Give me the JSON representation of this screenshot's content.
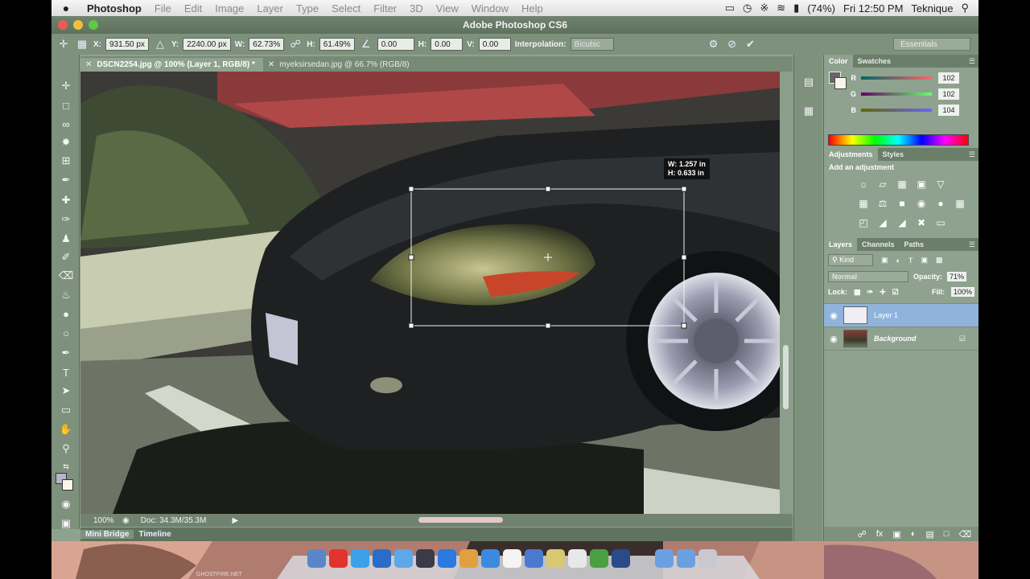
{
  "menubar": {
    "apple": "",
    "app": "Photoshop",
    "items": [
      "File",
      "Edit",
      "Image",
      "Layer",
      "Type",
      "Select",
      "Filter",
      "3D",
      "View",
      "Window",
      "Help"
    ],
    "battery": "(74%)",
    "clock": "Fri 12:50 PM",
    "user": "Teknique"
  },
  "window": {
    "title": "Adobe Photoshop CS6"
  },
  "options": {
    "x_label": "X:",
    "x_value": "931.50 px",
    "y_label": "Y:",
    "y_value": "2240.00 px",
    "w_label": "W:",
    "w_value": "62.73%",
    "h_label": "H:",
    "h_value": "61.49%",
    "angle_value": "0.00",
    "hskew_label": "H:",
    "hskew_value": "0.00",
    "vskew_label": "V:",
    "vskew_value": "0.00",
    "interp_label": "Interpolation:",
    "interp_value": "Bicubic",
    "workspace": "Essentials"
  },
  "doc_tabs": [
    {
      "label": "DSCN2254.jpg @ 100% (Layer 1, RGB/8) *",
      "active": true
    },
    {
      "label": "myeksirsedan.jpg @ 66.7% (RGB/8)",
      "active": false
    }
  ],
  "transform_readout": {
    "w": "W: 1.257 in",
    "h": "H: 0.633 in"
  },
  "status": {
    "zoom": "100%",
    "doc": "Doc: 34.3M/35.3M"
  },
  "bottom_tabs": [
    "Mini Bridge",
    "Timeline"
  ],
  "color_panel": {
    "tabs": [
      "Color",
      "Swatches"
    ],
    "channels": [
      {
        "name": "R",
        "value": "102"
      },
      {
        "name": "G",
        "value": "102"
      },
      {
        "name": "B",
        "value": "104"
      }
    ]
  },
  "adjustments_panel": {
    "tabs": [
      "Adjustments",
      "Styles"
    ],
    "hint": "Add an adjustment"
  },
  "layers_panel": {
    "tabs": [
      "Layers",
      "Channels",
      "Paths"
    ],
    "kind": "Kind",
    "blend": "Normal",
    "opacity_label": "Opacity:",
    "opacity_value": "71%",
    "lock_label": "Lock:",
    "fill_label": "Fill:",
    "fill_value": "100%",
    "layers": [
      {
        "name": "Layer 1",
        "selected": true
      },
      {
        "name": "Background",
        "selected": false
      }
    ]
  },
  "dock": {
    "watermark": "GHOSTFIRE.NET"
  },
  "colors": {
    "accent": "#8fa28f",
    "selection": "#90b3dc",
    "chrome": "#7d917d"
  }
}
